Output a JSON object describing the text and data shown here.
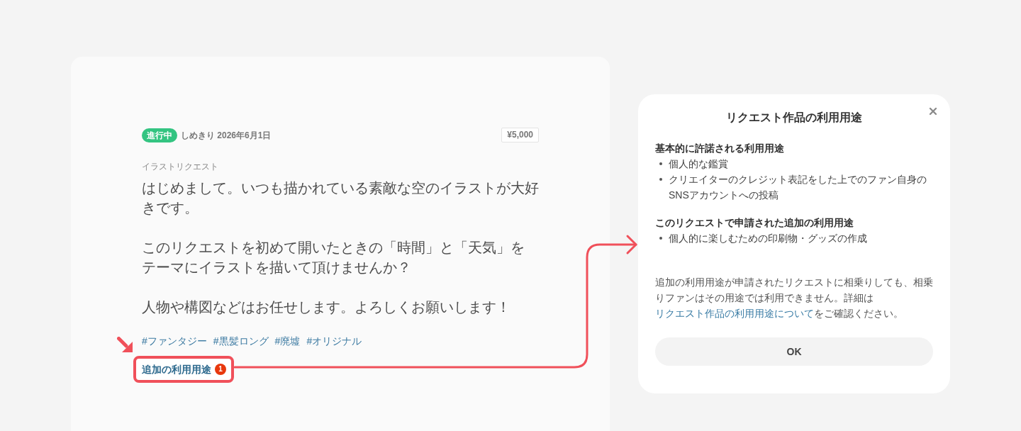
{
  "request_card": {
    "status": "進行中",
    "deadline": "しめきり 2026年6月1日",
    "price": "¥5,000",
    "category": "イラストリクエスト",
    "body": [
      "はじめまして。いつも描かれている素敵な空のイラストが大好きです。",
      "このリクエストを初めて開いたときの「時間」と「天気」をテーマにイラストを描いて頂けませんか？",
      "人物や構図などはお任せします。よろしくお願いします！"
    ],
    "tags": [
      "#ファンタジー",
      "#黒髪ロング",
      "#廃墟",
      "#オリジナル"
    ],
    "usage_link": {
      "label": "追加の利用用途",
      "badge": "1"
    }
  },
  "modal": {
    "title": "リクエスト作品の利用用途",
    "sections": [
      {
        "heading": "基本的に許諾される利用用途",
        "items": [
          "個人的な鑑賞",
          "クリエイターのクレジット表記をした上でのファン自身のSNSアカウントへの投稿"
        ]
      },
      {
        "heading": "このリクエストで申請された追加の利用用途",
        "items": [
          "個人的に楽しむための印刷物・グッズの作成"
        ]
      }
    ],
    "note": {
      "before": "追加の利用用途が申請されたリクエストに相乗りしても、相乗りファンはその用途では利用できません。詳細は",
      "link": "リクエスト作品の利用用途について",
      "after": "をご確認ください。"
    },
    "ok_button": "OK"
  }
}
